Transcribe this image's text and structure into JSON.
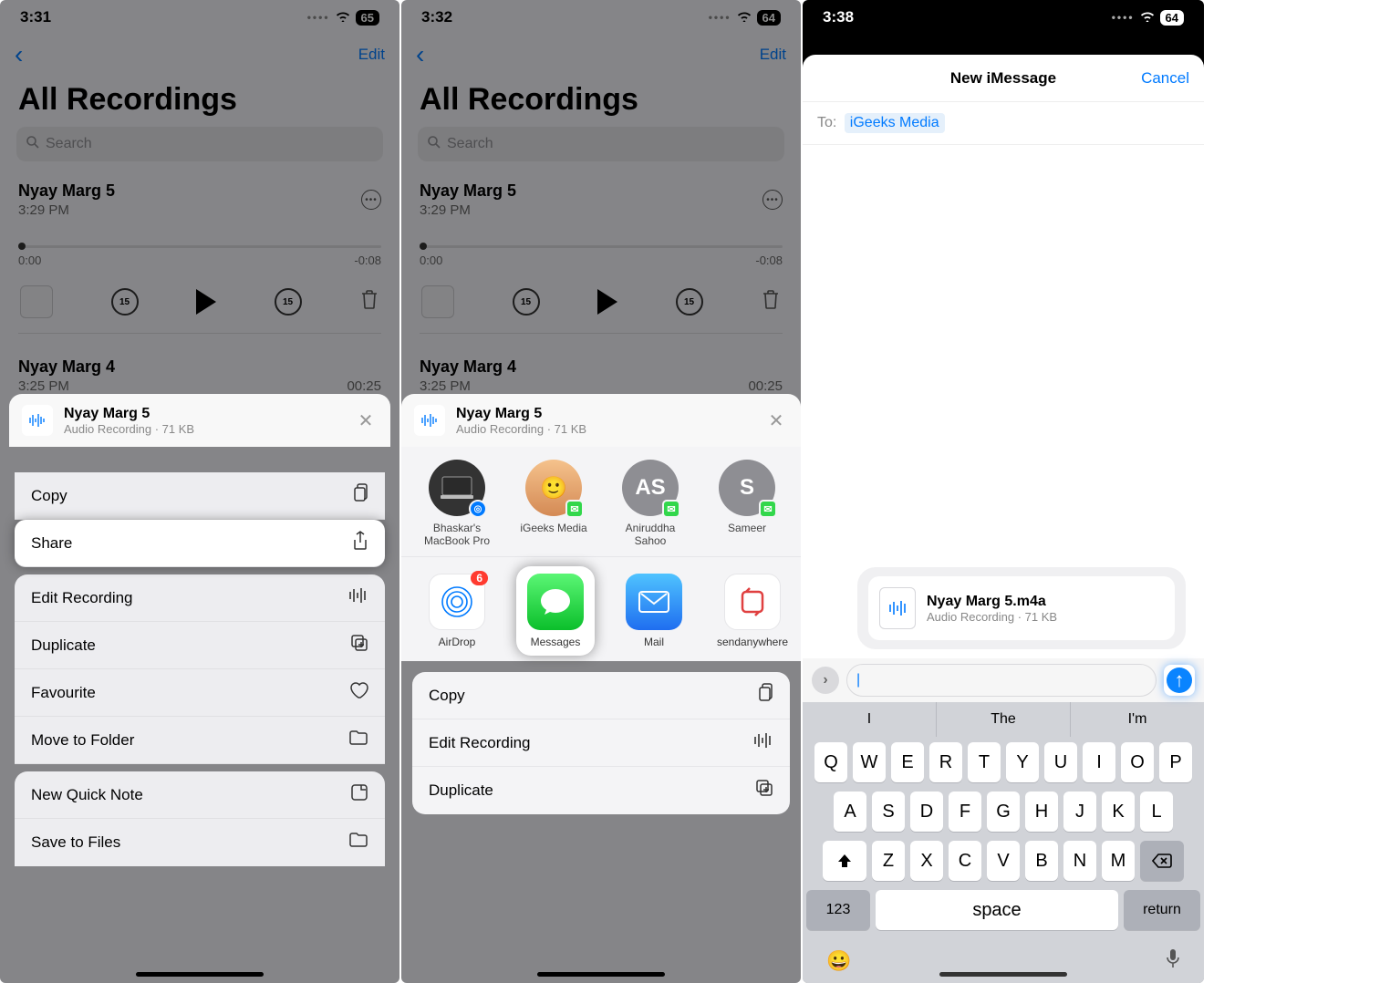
{
  "phone1": {
    "time": "3:31",
    "battery": "65",
    "edit": "Edit",
    "title": "All Recordings",
    "search_placeholder": "Search",
    "rec1": {
      "title": "Nyay Marg 5",
      "time": "3:29 PM",
      "pos": "0:00",
      "dur": "-0:08",
      "skip": "15"
    },
    "rec2": {
      "title": "Nyay Marg 4",
      "time": "3:25 PM",
      "dur": "00:25"
    },
    "sheet_item": {
      "title": "Nyay Marg 5",
      "sub": "Audio Recording · 71 KB"
    },
    "menu": {
      "copy": "Copy",
      "share": "Share",
      "edit_recording": "Edit Recording",
      "duplicate": "Duplicate",
      "favourite": "Favourite",
      "move": "Move to Folder",
      "quicknote": "New Quick Note",
      "savefiles": "Save to Files"
    }
  },
  "phone2": {
    "time": "3:32",
    "battery": "64",
    "edit": "Edit",
    "title": "All Recordings",
    "search_placeholder": "Search",
    "rec1": {
      "title": "Nyay Marg 5",
      "time": "3:29 PM",
      "pos": "0:00",
      "dur": "-0:08",
      "skip": "15"
    },
    "rec2": {
      "title": "Nyay Marg 4",
      "time": "3:25 PM",
      "dur": "00:25"
    },
    "sheet_item": {
      "title": "Nyay Marg 5",
      "sub": "Audio Recording · 71 KB"
    },
    "contacts": {
      "c1": "Bhaskar's MacBook Pro",
      "c2": "iGeeks Media",
      "c3": "Aniruddha Sahoo",
      "c3_initials": "AS",
      "c4": "Sameer",
      "c4_initials": "S"
    },
    "apps": {
      "airdrop": "AirDrop",
      "airdrop_badge": "6",
      "messages": "Messages",
      "mail": "Mail",
      "sendanywhere": "sendanywhere"
    },
    "actions": {
      "copy": "Copy",
      "edit_recording": "Edit Recording",
      "duplicate": "Duplicate"
    }
  },
  "phone3": {
    "time": "3:38",
    "battery": "64",
    "title": "New iMessage",
    "cancel": "Cancel",
    "to_label": "To:",
    "to_value": "iGeeks Media",
    "attach": {
      "title": "Nyay Marg 5.m4a",
      "sub": "Audio Recording · 71 KB"
    },
    "cursor": "|",
    "suggest": {
      "s1": "I",
      "s2": "The",
      "s3": "I'm"
    },
    "keys_r1": [
      "Q",
      "W",
      "E",
      "R",
      "T",
      "Y",
      "U",
      "I",
      "O",
      "P"
    ],
    "keys_r2": [
      "A",
      "S",
      "D",
      "F",
      "G",
      "H",
      "J",
      "K",
      "L"
    ],
    "keys_r3": [
      "Z",
      "X",
      "C",
      "V",
      "B",
      "N",
      "M"
    ],
    "num": "123",
    "space": "space",
    "ret": "return"
  }
}
